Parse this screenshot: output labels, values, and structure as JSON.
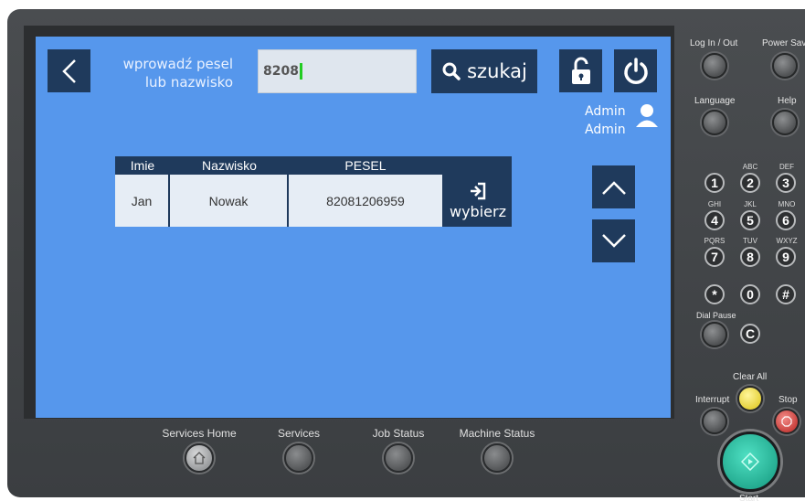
{
  "header": {
    "prompt_line1": "wprowadź pesel",
    "prompt_line2": "lub nazwisko",
    "search_value": "8208",
    "search_label": "szukaj"
  },
  "user": {
    "first": "Admin",
    "last": "Admin"
  },
  "table": {
    "columns": [
      "Imie",
      "Nazwisko",
      "PESEL"
    ],
    "rows": [
      {
        "imie": "Jan",
        "nazwisko": "Nowak",
        "pesel": "82081206959",
        "action": "wybierz"
      }
    ]
  },
  "bottom_buttons": [
    "Services Home",
    "Services",
    "Job Status",
    "Machine Status"
  ],
  "panel": {
    "login": "Log In / Out",
    "power": "Power Save",
    "language": "Language",
    "help": "Help",
    "keys": [
      {
        "main": "1",
        "sub": ""
      },
      {
        "main": "2",
        "sub": "ABC"
      },
      {
        "main": "3",
        "sub": "DEF"
      },
      {
        "main": "4",
        "sub": "GHI"
      },
      {
        "main": "5",
        "sub": "JKL"
      },
      {
        "main": "6",
        "sub": "MNO"
      },
      {
        "main": "7",
        "sub": "PQRS"
      },
      {
        "main": "8",
        "sub": "TUV"
      },
      {
        "main": "9",
        "sub": "WXYZ"
      },
      {
        "main": "*",
        "sub": ""
      },
      {
        "main": "0",
        "sub": ""
      },
      {
        "main": "#",
        "sub": ""
      }
    ],
    "dial_pause": "Dial Pause",
    "clear_key": "C",
    "clear_all": "Clear All",
    "interrupt": "Interrupt",
    "stop": "Stop",
    "start": "Start"
  },
  "colors": {
    "screen": "#5697ec",
    "navy": "#1f3a5c",
    "start": "#2ec4a8",
    "clear_all": "#f1e25a",
    "stop": "#d9534f"
  }
}
